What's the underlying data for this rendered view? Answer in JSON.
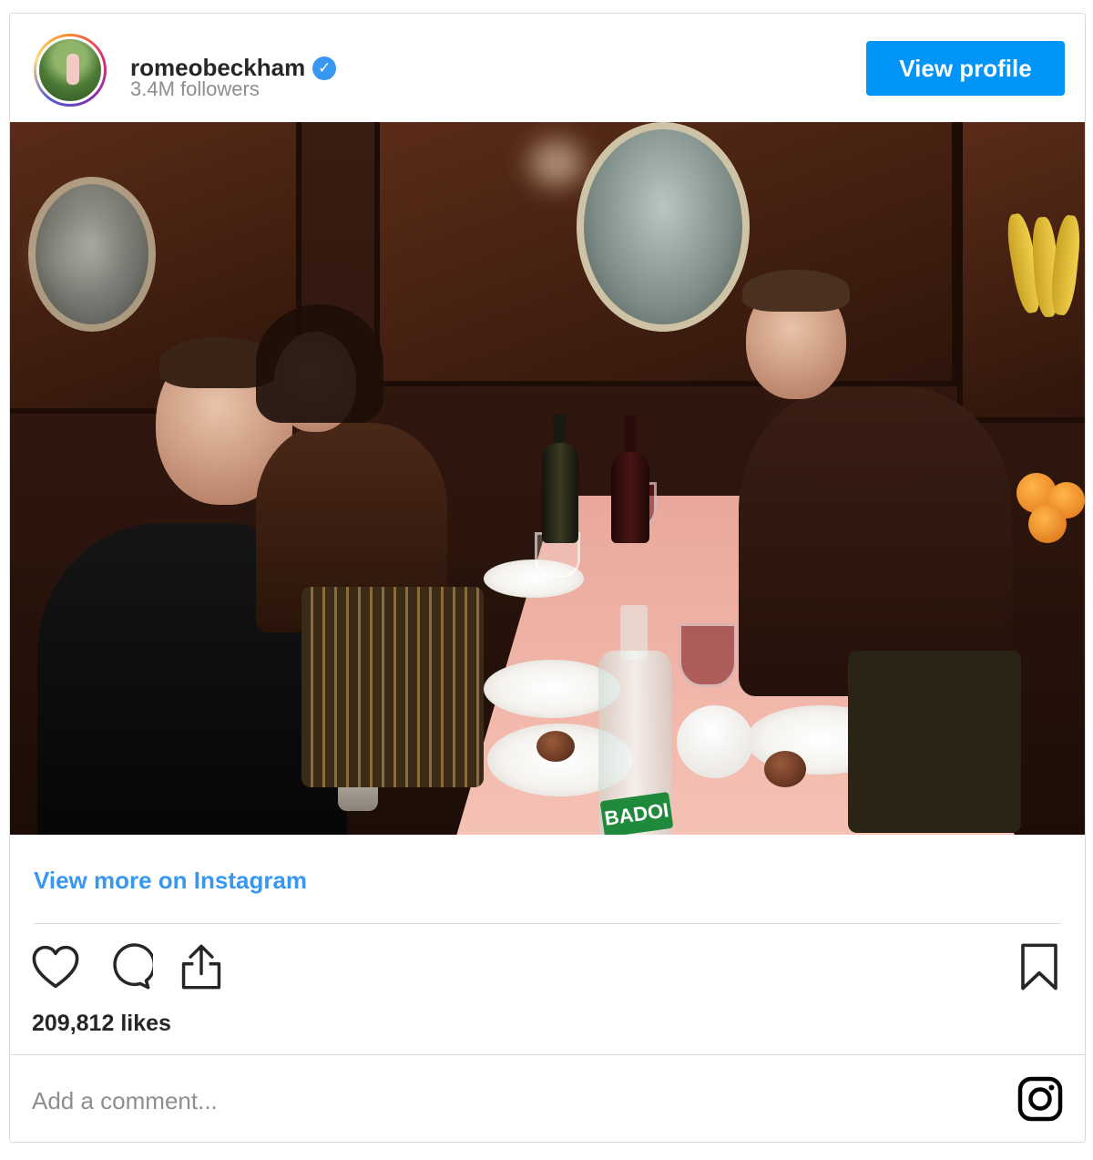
{
  "post": {
    "username": "romeobeckham",
    "verified": true,
    "followers": "3.4M followers",
    "view_profile_label": "View profile",
    "view_more_label": "View more on Instagram",
    "likes": "209,812 likes",
    "comment_placeholder": "Add a comment...",
    "bottle_label": "BADOI"
  },
  "icons": [
    "heart-icon",
    "comment-icon",
    "share-icon",
    "bookmark-icon",
    "instagram-logo-icon",
    "verified-badge-icon"
  ],
  "colors": {
    "accent": "#0095f6",
    "link": "#3897f0",
    "text": "#262626",
    "muted": "#8e8e8e",
    "border": "#dbdbdb"
  }
}
